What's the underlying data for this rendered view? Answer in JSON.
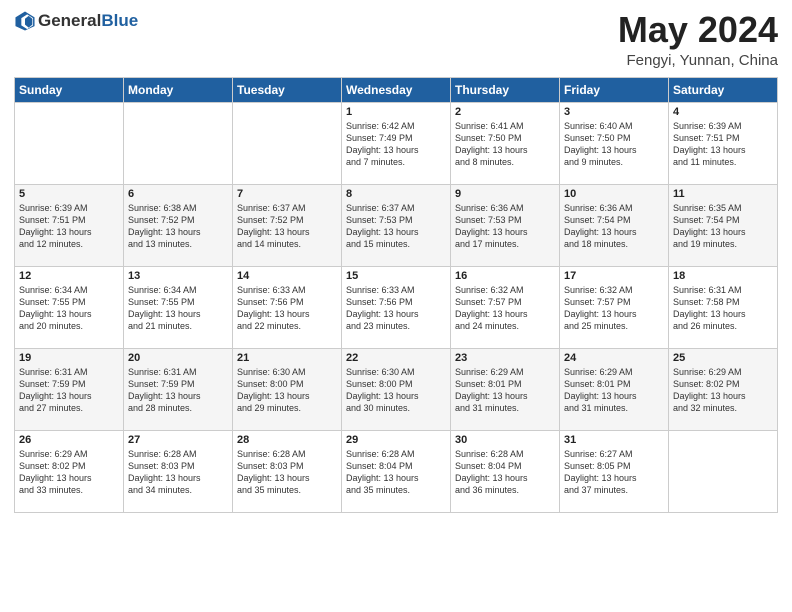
{
  "header": {
    "logo_general": "General",
    "logo_blue": "Blue",
    "month": "May 2024",
    "location": "Fengyi, Yunnan, China"
  },
  "days_of_week": [
    "Sunday",
    "Monday",
    "Tuesday",
    "Wednesday",
    "Thursday",
    "Friday",
    "Saturday"
  ],
  "weeks": [
    [
      {
        "date": "",
        "info": ""
      },
      {
        "date": "",
        "info": ""
      },
      {
        "date": "",
        "info": ""
      },
      {
        "date": "1",
        "info": "Sunrise: 6:42 AM\nSunset: 7:49 PM\nDaylight: 13 hours\nand 7 minutes."
      },
      {
        "date": "2",
        "info": "Sunrise: 6:41 AM\nSunset: 7:50 PM\nDaylight: 13 hours\nand 8 minutes."
      },
      {
        "date": "3",
        "info": "Sunrise: 6:40 AM\nSunset: 7:50 PM\nDaylight: 13 hours\nand 9 minutes."
      },
      {
        "date": "4",
        "info": "Sunrise: 6:39 AM\nSunset: 7:51 PM\nDaylight: 13 hours\nand 11 minutes."
      }
    ],
    [
      {
        "date": "5",
        "info": "Sunrise: 6:39 AM\nSunset: 7:51 PM\nDaylight: 13 hours\nand 12 minutes."
      },
      {
        "date": "6",
        "info": "Sunrise: 6:38 AM\nSunset: 7:52 PM\nDaylight: 13 hours\nand 13 minutes."
      },
      {
        "date": "7",
        "info": "Sunrise: 6:37 AM\nSunset: 7:52 PM\nDaylight: 13 hours\nand 14 minutes."
      },
      {
        "date": "8",
        "info": "Sunrise: 6:37 AM\nSunset: 7:53 PM\nDaylight: 13 hours\nand 15 minutes."
      },
      {
        "date": "9",
        "info": "Sunrise: 6:36 AM\nSunset: 7:53 PM\nDaylight: 13 hours\nand 17 minutes."
      },
      {
        "date": "10",
        "info": "Sunrise: 6:36 AM\nSunset: 7:54 PM\nDaylight: 13 hours\nand 18 minutes."
      },
      {
        "date": "11",
        "info": "Sunrise: 6:35 AM\nSunset: 7:54 PM\nDaylight: 13 hours\nand 19 minutes."
      }
    ],
    [
      {
        "date": "12",
        "info": "Sunrise: 6:34 AM\nSunset: 7:55 PM\nDaylight: 13 hours\nand 20 minutes."
      },
      {
        "date": "13",
        "info": "Sunrise: 6:34 AM\nSunset: 7:55 PM\nDaylight: 13 hours\nand 21 minutes."
      },
      {
        "date": "14",
        "info": "Sunrise: 6:33 AM\nSunset: 7:56 PM\nDaylight: 13 hours\nand 22 minutes."
      },
      {
        "date": "15",
        "info": "Sunrise: 6:33 AM\nSunset: 7:56 PM\nDaylight: 13 hours\nand 23 minutes."
      },
      {
        "date": "16",
        "info": "Sunrise: 6:32 AM\nSunset: 7:57 PM\nDaylight: 13 hours\nand 24 minutes."
      },
      {
        "date": "17",
        "info": "Sunrise: 6:32 AM\nSunset: 7:57 PM\nDaylight: 13 hours\nand 25 minutes."
      },
      {
        "date": "18",
        "info": "Sunrise: 6:31 AM\nSunset: 7:58 PM\nDaylight: 13 hours\nand 26 minutes."
      }
    ],
    [
      {
        "date": "19",
        "info": "Sunrise: 6:31 AM\nSunset: 7:59 PM\nDaylight: 13 hours\nand 27 minutes."
      },
      {
        "date": "20",
        "info": "Sunrise: 6:31 AM\nSunset: 7:59 PM\nDaylight: 13 hours\nand 28 minutes."
      },
      {
        "date": "21",
        "info": "Sunrise: 6:30 AM\nSunset: 8:00 PM\nDaylight: 13 hours\nand 29 minutes."
      },
      {
        "date": "22",
        "info": "Sunrise: 6:30 AM\nSunset: 8:00 PM\nDaylight: 13 hours\nand 30 minutes."
      },
      {
        "date": "23",
        "info": "Sunrise: 6:29 AM\nSunset: 8:01 PM\nDaylight: 13 hours\nand 31 minutes."
      },
      {
        "date": "24",
        "info": "Sunrise: 6:29 AM\nSunset: 8:01 PM\nDaylight: 13 hours\nand 31 minutes."
      },
      {
        "date": "25",
        "info": "Sunrise: 6:29 AM\nSunset: 8:02 PM\nDaylight: 13 hours\nand 32 minutes."
      }
    ],
    [
      {
        "date": "26",
        "info": "Sunrise: 6:29 AM\nSunset: 8:02 PM\nDaylight: 13 hours\nand 33 minutes."
      },
      {
        "date": "27",
        "info": "Sunrise: 6:28 AM\nSunset: 8:03 PM\nDaylight: 13 hours\nand 34 minutes."
      },
      {
        "date": "28",
        "info": "Sunrise: 6:28 AM\nSunset: 8:03 PM\nDaylight: 13 hours\nand 35 minutes."
      },
      {
        "date": "29",
        "info": "Sunrise: 6:28 AM\nSunset: 8:04 PM\nDaylight: 13 hours\nand 35 minutes."
      },
      {
        "date": "30",
        "info": "Sunrise: 6:28 AM\nSunset: 8:04 PM\nDaylight: 13 hours\nand 36 minutes."
      },
      {
        "date": "31",
        "info": "Sunrise: 6:27 AM\nSunset: 8:05 PM\nDaylight: 13 hours\nand 37 minutes."
      },
      {
        "date": "",
        "info": ""
      }
    ]
  ]
}
